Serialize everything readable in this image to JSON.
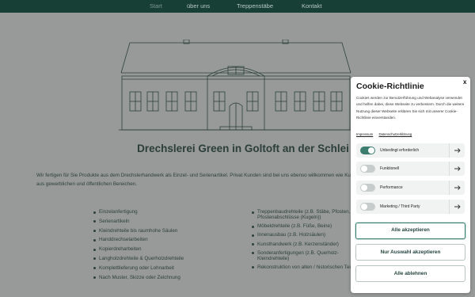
{
  "nav": {
    "items": [
      {
        "label": "Start"
      },
      {
        "label": "über uns"
      },
      {
        "label": "Treppenstäbe"
      },
      {
        "label": "Kontakt"
      }
    ]
  },
  "page": {
    "title": "Drechslerei Green in Goltoft an der Schlei",
    "intro": "Wir fertigen für Sie Produkte aus dem Drechslerhandwerk als Einzel- und Serienartikel. Privat Kunden sind bei uns ebenso willkommen wie Kunden aus gewerblichen und öffentlichen Bereichen."
  },
  "services_left": [
    "Einzelanfertigung",
    "Serienartikeln",
    "Kleindrehteile bis raumhohe Säulen",
    "Handdrechselarbeiten",
    "Kopierdreharbeiten",
    "Langholzdrehteile & Querholzdrehteile",
    "Komplettlieferung oder Lohnarbeit",
    "Nach Muster, Skizze oder Zeichnung"
  ],
  "services_right": [
    {
      "line1": "Treppenbaudrehteile (z.B. Stäbe, Pfosten,",
      "line2": "Pfostenabschlüsse (Kugeln))"
    },
    {
      "line1": "Möbeldrehteile (z.B. Füße, Beine)"
    },
    {
      "line1": "Innenausbau (z.B. Holzsäulen)"
    },
    {
      "line1": "Kunsthandwerk (z.B. Kerzenständer)"
    },
    {
      "line1": "Sonderanfertigungen (z.B. Querholz-",
      "line2": "Kleindrehteile)"
    },
    {
      "line1": "Rekonstruktion von alten / historischen Teilen"
    }
  ],
  "cookie": {
    "title": "Cookie-Richtlinie",
    "close_label": "x",
    "text": "Cookies werden zur Benutzerführung und Webanalyse verwendet und helfen dabei, diese Webseite zu verbessern. Durch die weitere Nutzung dieser Webseite erklären Sie sich mit unserer Cookie-Richtlinie einverstanden.",
    "links": {
      "impressum": "Impressum",
      "privacy": "Datenschutzerklärung"
    },
    "categories": [
      {
        "label": "Unbedingt erforderlich",
        "enabled": true
      },
      {
        "label": "Funktionell",
        "enabled": false
      },
      {
        "label": "Performance",
        "enabled": false
      },
      {
        "label": "Marketing / Third Party",
        "enabled": false
      }
    ],
    "accept_all": "Alle akzeptieren",
    "accept_selection": "Nur Auswahl akzeptieren",
    "reject_all": "Alle ablehnen"
  },
  "colors": {
    "brand": "#173f36",
    "accent": "#3d7d70"
  }
}
